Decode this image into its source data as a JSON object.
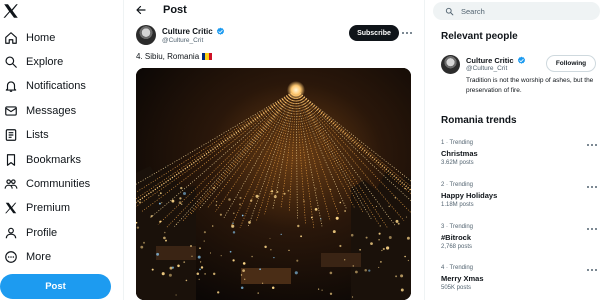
{
  "nav": {
    "items": [
      {
        "label": "Home",
        "icon": "home-icon"
      },
      {
        "label": "Explore",
        "icon": "search-icon"
      },
      {
        "label": "Notifications",
        "icon": "bell-icon"
      },
      {
        "label": "Messages",
        "icon": "envelope-icon"
      },
      {
        "label": "Lists",
        "icon": "list-icon"
      },
      {
        "label": "Bookmarks",
        "icon": "bookmark-icon"
      },
      {
        "label": "Communities",
        "icon": "people-icon"
      },
      {
        "label": "Premium",
        "icon": "x-logo-icon"
      },
      {
        "label": "Profile",
        "icon": "person-icon"
      },
      {
        "label": "More",
        "icon": "more-circle-icon"
      }
    ],
    "post_button": "Post"
  },
  "header": {
    "title": "Post"
  },
  "tweet": {
    "author_name": "Culture Critic",
    "author_handle": "@Culture_Crit",
    "subscribe_label": "Subscribe",
    "text": "4. Sibiu, Romania",
    "flag": [
      "#002b7f",
      "#fcd116",
      "#ce1126"
    ]
  },
  "search": {
    "placeholder": "Search"
  },
  "relevant": {
    "title": "Relevant people",
    "name": "Culture Critic",
    "handle": "@Culture_Crit",
    "follow_label": "Following",
    "bio": "Tradition is not the worship of ashes, but the preservation of fire."
  },
  "trends": {
    "title": "Romania trends",
    "items": [
      {
        "meta": "1 · Trending",
        "name": "Christmas",
        "posts": "3.62M posts"
      },
      {
        "meta": "2 · Trending",
        "name": "Happy Holidays",
        "posts": "1.18M posts"
      },
      {
        "meta": "3 · Trending",
        "name": "#Bitrock",
        "posts": "2,768 posts"
      },
      {
        "meta": "4 · Trending",
        "name": "Merry Xmas",
        "posts": "505K posts"
      }
    ]
  },
  "colors": {
    "accent": "#1d9bf0",
    "text": "#0f1419",
    "muted": "#536471",
    "dark_button": "#0f1419"
  }
}
